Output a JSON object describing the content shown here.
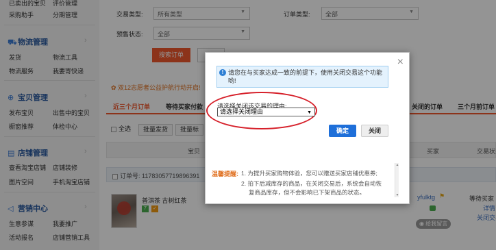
{
  "sidebar": {
    "top_rows": [
      {
        "a": "已卖出的宝贝",
        "b": "评价管理"
      },
      {
        "a": "采购助手",
        "b": "分期管理"
      }
    ],
    "sections": [
      {
        "title": "物流管理",
        "icon": "truck-icon",
        "rows": [
          {
            "a": "发货",
            "b": "物流工具"
          },
          {
            "a": "物流服务",
            "b": "我要寄快递"
          }
        ]
      },
      {
        "title": "宝贝管理",
        "icon": "box-icon",
        "rows": [
          {
            "a": "发布宝贝",
            "b": "出售中的宝贝"
          },
          {
            "a": "橱窗推荐",
            "b": "体检中心"
          }
        ]
      },
      {
        "title": "店铺管理",
        "icon": "shop-icon",
        "rows": [
          {
            "a": "查看淘宝店铺",
            "b": "店铺装修"
          },
          {
            "a": "图片空间",
            "b": "手机淘宝店铺"
          }
        ]
      },
      {
        "title": "营销中心",
        "icon": "megaphone-icon",
        "rows": [
          {
            "a": "生意参谋",
            "b": "我要推广"
          },
          {
            "a": "活动报名",
            "b": "店铺营销工具"
          }
        ]
      }
    ]
  },
  "filters": {
    "trade_type_label": "交易类型:",
    "trade_type_value": "所有类型",
    "order_type_label": "订单类型:",
    "order_type_value": "全部",
    "presale_label": "预售状态:",
    "presale_value": "全部",
    "search_button": "搜索订单"
  },
  "notice": "✿ 双12志愿者公益护航行动开启!",
  "tabs": [
    {
      "label": "近三个月订单",
      "active": true
    },
    {
      "label": "等待买家付款",
      "active": false
    },
    {
      "label": "关闭的订单",
      "active": false
    },
    {
      "label": "三个月前订单",
      "active": false
    }
  ],
  "actions": {
    "select_all": "全选",
    "batch_ship": "批量发货",
    "batch_mark": "批量标"
  },
  "table": {
    "col_item": "宝贝",
    "col_buyer": "买家",
    "col_status": "交易状态"
  },
  "order": {
    "number": "订单号: 11783057719896391",
    "item_title": "普洱茶 古树红茶",
    "buyer": "yfulktg",
    "leave_msg": "给我留言",
    "status_line1": "等待买家",
    "status_line2": "详情",
    "status_line3": "关闭交易"
  },
  "modal": {
    "info_text": "请您在与买家达成一致的前提下，使用关闭交易这个功能哟!",
    "reason_label": "请选择关闭该交易的理由:",
    "reason_value": "请选择关闭理由",
    "confirm_button": "确定",
    "close_button": "关闭",
    "tip_title": "温馨提醒:",
    "tip_1": "1. 为提升买家购物体验，您可以赠送买家店铺优惠券;",
    "tip_2a": "2. 拍下后减库存的商品，在关闭交易后，系统会自动恢",
    "tip_2b": "复商品库存，但不会影响已下架商品的状态。"
  }
}
